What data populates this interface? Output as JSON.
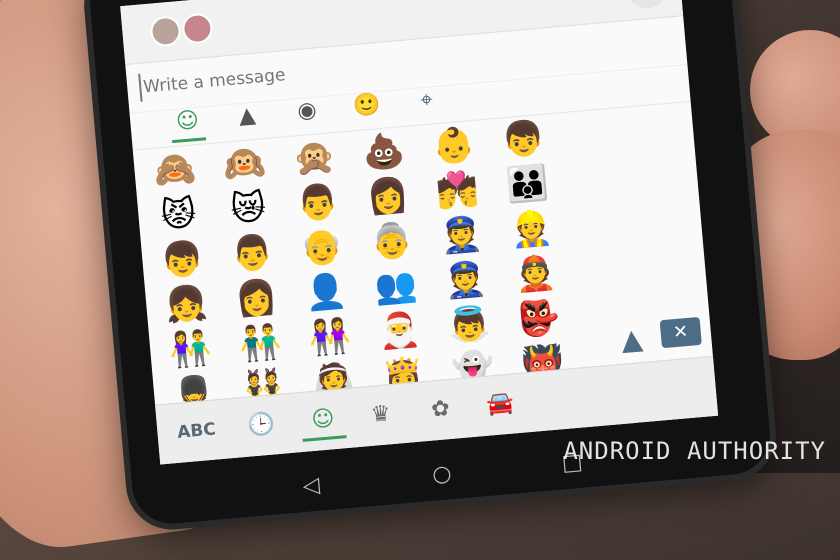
{
  "message": {
    "placeholder": "Write a message",
    "send_icon": "➤"
  },
  "header": {
    "avatars": [
      "avatar-1",
      "avatar-2"
    ]
  },
  "tools": [
    {
      "name": "sticker-icon",
      "glyph": "🙂"
    },
    {
      "name": "location-icon",
      "glyph": "⌖"
    }
  ],
  "category_tabs": [
    {
      "name": "tab-smileys",
      "glyph": "☺",
      "active": true
    },
    {
      "name": "tab-photos",
      "glyph": "▲",
      "active": false
    },
    {
      "name": "tab-camera",
      "glyph": "◉",
      "active": false
    }
  ],
  "emoji_rows": [
    [
      "🙈",
      "🙉",
      "🙊",
      "💩",
      "👶",
      "👦"
    ],
    [
      "😾",
      "😿",
      "👨",
      "👩",
      "💏",
      "👪"
    ],
    [
      "👦",
      "👨",
      "👴",
      "👵",
      "👮",
      "👷"
    ],
    [
      "👧",
      "👩",
      "👤",
      "👥",
      "👮",
      "👲"
    ],
    [
      "👫",
      "👬",
      "👭",
      "🎅",
      "👼",
      "👺"
    ],
    [
      "💂",
      "👯",
      "👰",
      "👸",
      "👻",
      "👹"
    ]
  ],
  "bottom_bar": {
    "abc_label": "ABC",
    "recent_glyph": "🕒",
    "smiley_glyph": "☺",
    "crown_glyph": "♛",
    "flower_glyph": "✿",
    "car_glyph": "🚘",
    "shift_glyph": "▲",
    "backspace_glyph": "✕"
  },
  "nav": {
    "back": "◁",
    "home": "○",
    "recent": "□"
  },
  "watermark": "ANDROID AUTHORITY"
}
